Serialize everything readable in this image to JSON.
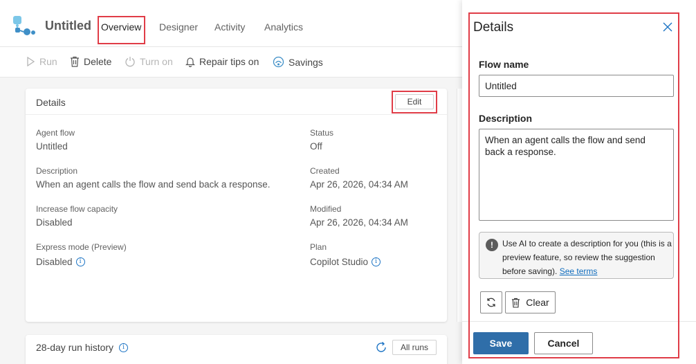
{
  "header": {
    "title": "Untitled",
    "tabs": [
      "Overview",
      "Designer",
      "Activity",
      "Analytics"
    ]
  },
  "commands": {
    "run": "Run",
    "delete": "Delete",
    "turn_on": "Turn on",
    "repair_tips": "Repair tips on",
    "savings": "Savings"
  },
  "details_card": {
    "title": "Details",
    "edit": "Edit",
    "fields": [
      {
        "label": "Agent flow",
        "value": "Untitled"
      },
      {
        "label": "Status",
        "value": "Off"
      },
      {
        "label": "Description",
        "value": "When an agent calls the flow and send back a response."
      },
      {
        "label": "Created",
        "value": "Apr 26, 2026, 04:34 AM"
      },
      {
        "label": "Increase flow capacity",
        "value": "Disabled"
      },
      {
        "label": "Modified",
        "value": "Apr 26, 2026, 04:34 AM"
      },
      {
        "label": "Express mode (Preview)",
        "value": "Disabled"
      },
      {
        "label": "Plan",
        "value": "Copilot Studio"
      }
    ]
  },
  "run_history": {
    "title": "28-day run history",
    "all_runs": "All runs"
  },
  "panel": {
    "title": "Details",
    "flow_name_label": "Flow name",
    "flow_name_value": "Untitled",
    "description_label": "Description",
    "description_value": "When an agent calls the flow and send back a response.",
    "ai_note": "Use AI to create a description for you (this is a preview feature, so review the suggestion before saving).",
    "ai_link": "See terms",
    "clear": "Clear",
    "save": "Save",
    "cancel": "Cancel"
  },
  "colors": {
    "highlight": "#e03c47",
    "primary": "#2f6ea9",
    "link": "#0f6cbd"
  },
  "icons": [
    "flow-logo-icon",
    "play-icon",
    "trash-icon",
    "power-icon",
    "bell-icon",
    "savings-icon",
    "info-icon",
    "refresh-icon",
    "close-icon",
    "alert-icon"
  ]
}
